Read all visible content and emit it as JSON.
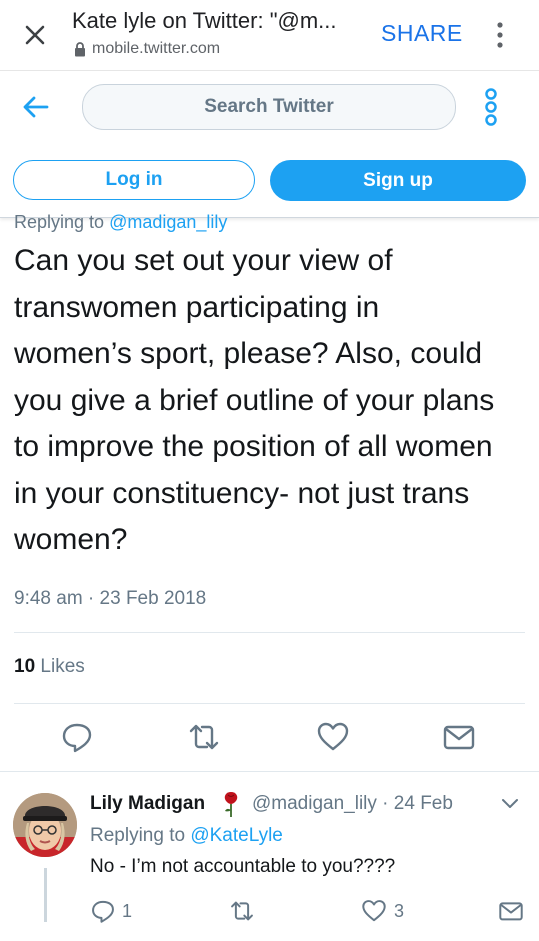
{
  "browser": {
    "title": "Kate lyle on Twitter: \"@m...",
    "url": "mobile.twitter.com",
    "share_label": "SHARE"
  },
  "header": {
    "search_placeholder": "Search Twitter",
    "login_label": "Log in",
    "signup_label": "Sign up"
  },
  "tweet": {
    "replying_prefix": "Replying to ",
    "replying_handle": "@madigan_lily",
    "text": "Can you set out  your view of\ntranswomen participating in\nwomen’s sport, please? Also, could\nyou give a brief outline of your plans\nto improve the position of all women\nin your constituency- not just trans\nwomen?",
    "timestamp": "9:48 am · 23 Feb 2018",
    "likes_count": "10",
    "likes_label": " Likes"
  },
  "reply": {
    "name": "Lily Madigan",
    "handle_date": "@madigan_lily · 24 Feb",
    "replying_prefix": "Replying to ",
    "replying_handle": "@KateLyle",
    "text": "No - I’m not accountable to you????",
    "reply_count": "1",
    "like_count": "3"
  },
  "colors": {
    "accent": "#1da1f2",
    "muted": "#657786",
    "text": "#14171a",
    "rose": "#c0121c"
  }
}
